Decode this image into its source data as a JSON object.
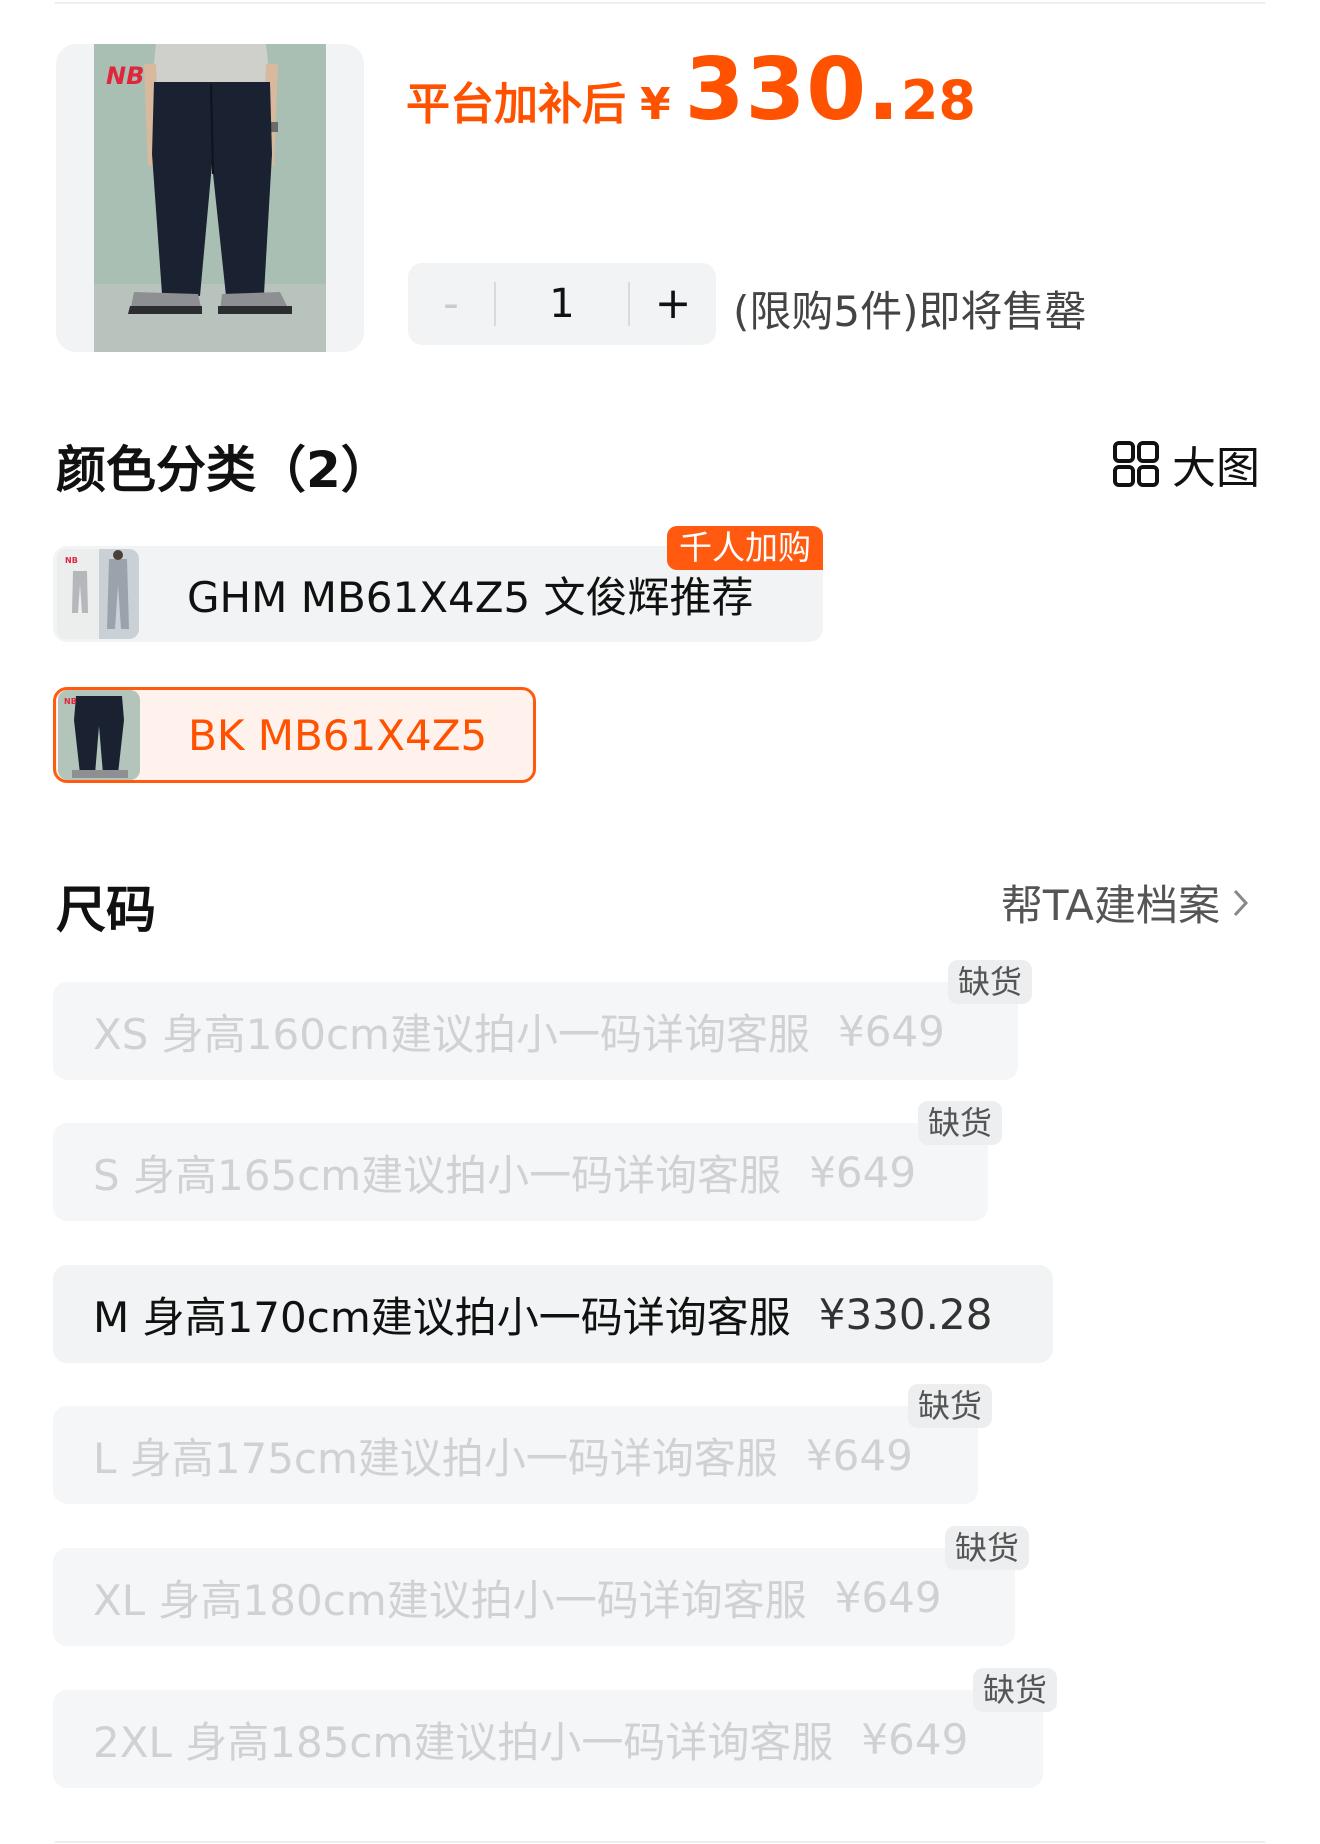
{
  "product": {
    "price_prefix": "平台加补后",
    "currency": "¥",
    "price_integer": "330.",
    "price_decimal": "28",
    "brand_mark": "NB"
  },
  "quantity": {
    "minus": "-",
    "value": "1",
    "plus": "+",
    "limit_text": "(限购5件)即将售罄"
  },
  "colors": {
    "title": "颜色分类（2）",
    "bigview_label": "大图",
    "options": [
      {
        "label": "GHM MB61X4Z5 文俊辉推荐",
        "badge": "千人加购",
        "selected": false
      },
      {
        "label": "BK MB61X4Z5",
        "badge": "",
        "selected": true
      }
    ]
  },
  "sizes": {
    "title": "尺码",
    "archive_label": "帮TA建档案",
    "out_of_stock_label": "缺货",
    "options": [
      {
        "label": "XS 身高160cm建议拍小一码详询客服",
        "price": "¥649",
        "available": false
      },
      {
        "label": "S 身高165cm建议拍小一码详询客服",
        "price": "¥649",
        "available": false
      },
      {
        "label": "M 身高170cm建议拍小一码详询客服",
        "price": "¥330.28",
        "available": true
      },
      {
        "label": "L 身高175cm建议拍小一码详询客服",
        "price": "¥649",
        "available": false
      },
      {
        "label": "XL 身高180cm建议拍小一码详询客服",
        "price": "¥649",
        "available": false
      },
      {
        "label": "2XL 身高185cm建议拍小一码详询客服",
        "price": "¥649",
        "available": false
      }
    ]
  },
  "colors_palette": {
    "accent": "#ff5200",
    "chip_bg": "#f1f3f4"
  }
}
